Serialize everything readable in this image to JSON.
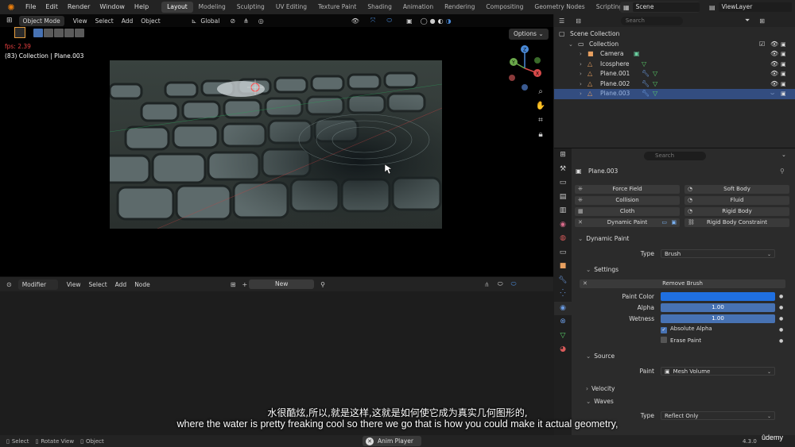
{
  "topbar": {
    "menus": [
      "File",
      "Edit",
      "Render",
      "Window",
      "Help"
    ],
    "workspaces": [
      "Layout",
      "Modeling",
      "Sculpting",
      "UV Editing",
      "Texture Paint",
      "Shading",
      "Animation",
      "Rendering",
      "Compositing",
      "Geometry Nodes",
      "Scripting"
    ],
    "active_workspace": "Layout",
    "add_tab": "+",
    "scene": "Scene",
    "view_layer": "ViewLayer"
  },
  "viewport": {
    "mode": "Object Mode",
    "menus": [
      "View",
      "Select",
      "Add",
      "Object"
    ],
    "transform_orientation": "Global",
    "fps": "fps: 2.39",
    "collection_info": "(83) Collection | Plane.003",
    "options": "Options",
    "gizmo_axes": [
      "X",
      "Y",
      "Z"
    ]
  },
  "node_editor": {
    "type": "Modifier",
    "menus": [
      "View",
      "Select",
      "Add",
      "Node"
    ],
    "new_label": "New"
  },
  "outliner": {
    "search_placeholder": "Search",
    "rows": [
      {
        "label": "Scene Collection",
        "icon": "scene-collection-icon"
      },
      {
        "label": "Collection",
        "icon": "collection-icon"
      },
      {
        "label": "Camera",
        "icon": "camera-object-icon"
      },
      {
        "label": "Icosphere",
        "icon": "mesh-object-icon"
      },
      {
        "label": "Plane.001",
        "icon": "mesh-object-icon"
      },
      {
        "label": "Plane.002",
        "icon": "mesh-object-icon"
      },
      {
        "label": "Plane.003",
        "icon": "mesh-object-icon",
        "selected": true
      }
    ]
  },
  "properties": {
    "search_placeholder": "Search",
    "object_name": "Plane.003",
    "physics_buttons": [
      [
        "Force Field",
        "Soft Body"
      ],
      [
        "Collision",
        "Fluid"
      ],
      [
        "Cloth",
        "Rigid Body"
      ],
      [
        "Dynamic Paint",
        "Rigid Body Constraint"
      ]
    ],
    "dynamic_paint": {
      "header": "Dynamic Paint",
      "type_label": "Type",
      "type_value": "Brush",
      "settings_header": "Settings",
      "remove_brush": "Remove Brush",
      "paint_color_label": "Paint Color",
      "paint_color": "#1f6fe0",
      "alpha_label": "Alpha",
      "alpha_value": "1.00",
      "wetness_label": "Wetness",
      "wetness_value": "1.00",
      "absolute_alpha": "Absolute Alpha",
      "erase_paint": "Erase Paint",
      "source_header": "Source",
      "paint_label": "Paint",
      "paint_value": "Mesh Volume",
      "velocity_header": "Velocity",
      "waves_header": "Waves",
      "waves_type_label": "Type",
      "waves_type_value": "Reflect Only"
    }
  },
  "statusbar": {
    "select": "Select",
    "rotate_view": "Rotate View",
    "object": "Object",
    "anim_player": "Anim Player",
    "version": "4.3.0",
    "udemy": "ûdemy"
  },
  "subtitles": {
    "chinese": "水很酷炫,所以,就是这样,这就是如何使它成为真实几何图形的,",
    "english": "where the water is pretty freaking cool so there we go that is how you could make it actual geometry,"
  },
  "colors": {
    "accent": "#4772b3",
    "selection": "#334d80",
    "fps_text": "#e84040"
  }
}
